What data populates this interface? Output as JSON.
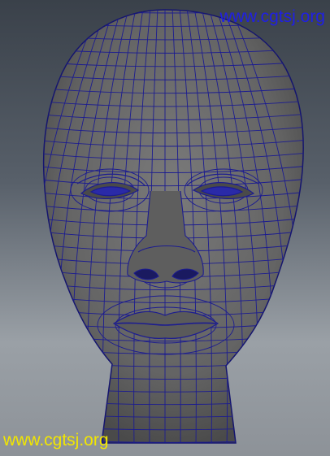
{
  "viewport": {
    "background_top": "#3a414a",
    "background_bottom": "#9aa0a6",
    "mesh_fill": "#6b6b6b",
    "wireframe_color": "#1a1a8c",
    "eye_color": "#2a2aa8"
  },
  "watermarks": {
    "top": {
      "text": "www.cgtsj.org",
      "color": "#1f1fe6"
    },
    "bottom": {
      "text": "www.cgtsj.org",
      "color": "#f2e600"
    }
  }
}
